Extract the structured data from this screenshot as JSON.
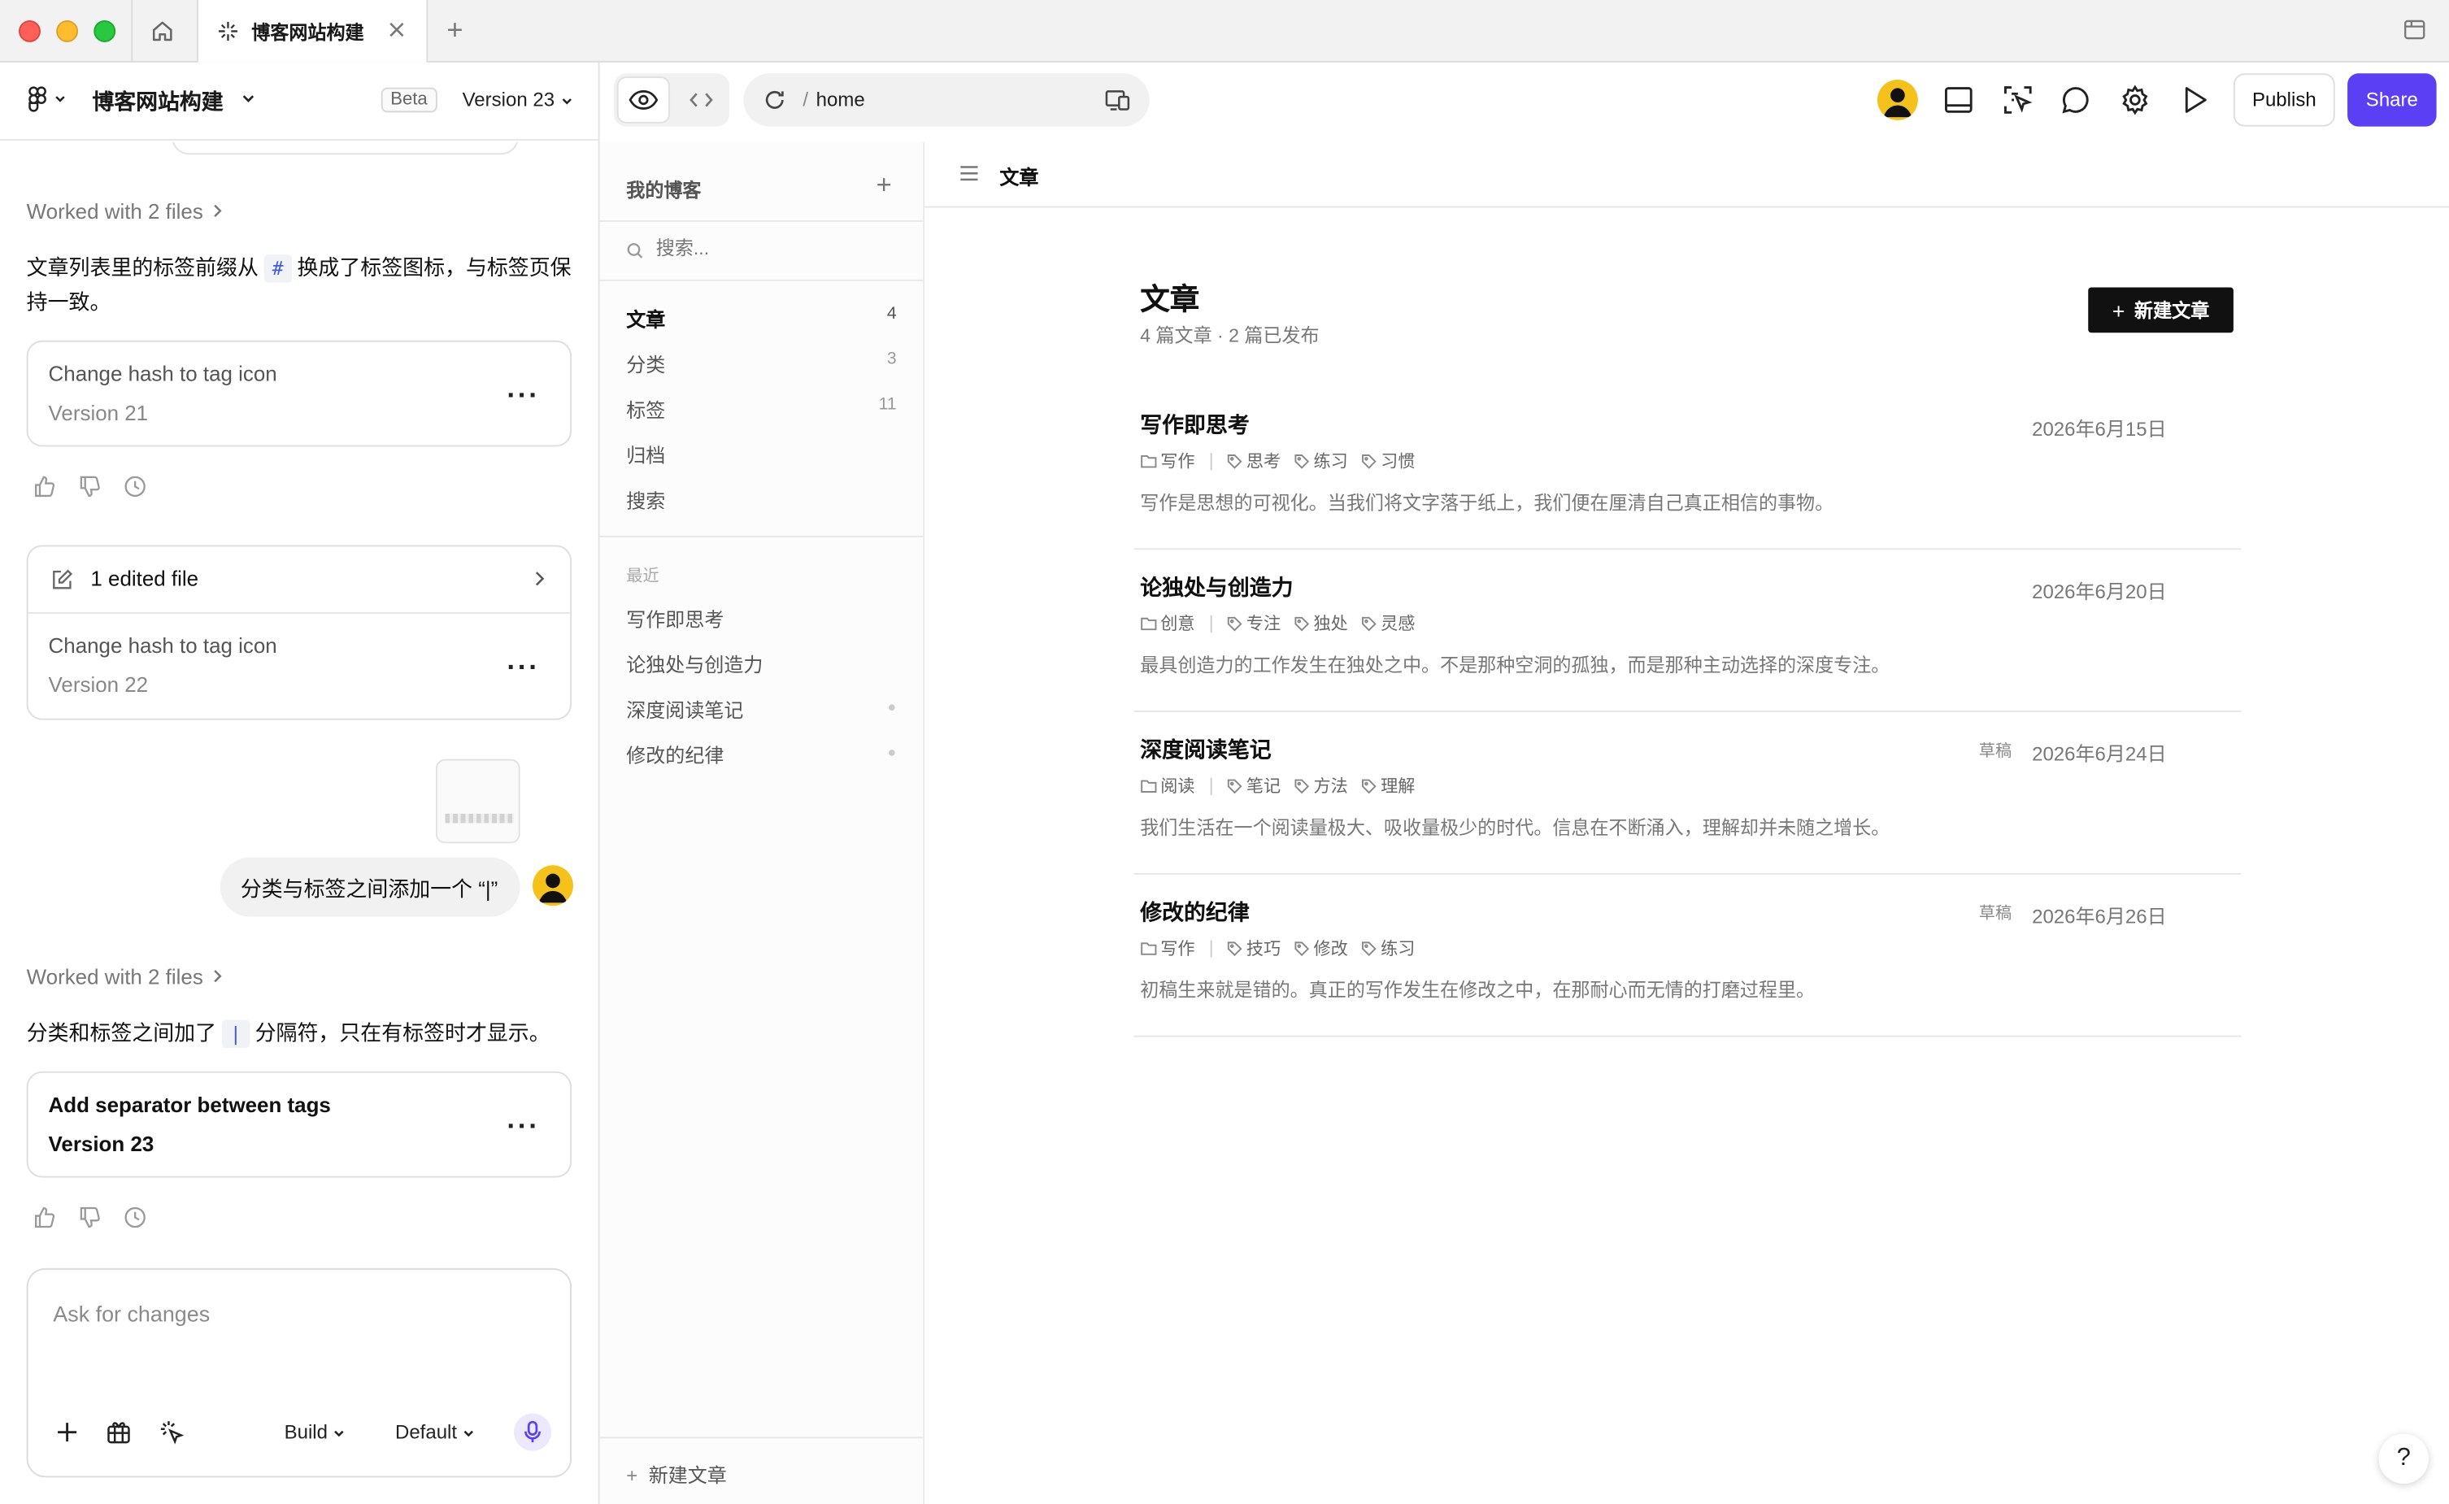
{
  "window": {
    "tab_title": "博客网站构建"
  },
  "toolbar": {
    "project_title": "博客网站构建",
    "beta_label": "Beta",
    "version_label": "Version 23",
    "url_path": "home",
    "publish_label": "Publish",
    "share_label": "Share",
    "accent_color": "#5b3ff5"
  },
  "chat": {
    "worked_1": "Worked with 2 files",
    "msg_1_before": "文章列表里的标签前缀从",
    "msg_1_chip": "#",
    "msg_1_after": "换成了标签图标，与标签页保持一致。",
    "card_1": {
      "title": "Change hash to tag icon",
      "version": "Version 21"
    },
    "edited_files_label": "1 edited file",
    "card_2": {
      "title": "Change hash to tag icon",
      "version": "Version 22"
    },
    "user_message": "分类与标签之间添加一个 “|”",
    "worked_2": "Worked with 2 files",
    "msg_2_before": "分类和标签之间加了",
    "msg_2_chip": "|",
    "msg_2_after": "分隔符，只在有标签时才显示。",
    "card_3": {
      "title": "Add separator between tags",
      "version": "Version 23"
    },
    "composer": {
      "placeholder": "Ask for changes",
      "mode": "Build",
      "model": "Default"
    }
  },
  "blog_sidebar": {
    "title": "我的博客",
    "search_placeholder": "搜索...",
    "nav": [
      {
        "label": "文章",
        "count": "4"
      },
      {
        "label": "分类",
        "count": "3"
      },
      {
        "label": "标签",
        "count": "11"
      },
      {
        "label": "归档",
        "count": ""
      },
      {
        "label": "搜索",
        "count": ""
      }
    ],
    "recent_heading": "最近",
    "recent": [
      {
        "label": "写作即思考"
      },
      {
        "label": "论独处与创造力"
      },
      {
        "label": "深度阅读笔记"
      },
      {
        "label": "修改的纪律"
      }
    ],
    "new_post": "新建文章"
  },
  "blog_main": {
    "header_title": "文章",
    "page_title": "文章",
    "subtitle": "4 篇文章 · 2 篇已发布",
    "new_post_button": "新建文章",
    "posts": [
      {
        "title": "写作即思考",
        "date": "2026年6月15日",
        "draft": "",
        "category": "写作",
        "tags": [
          "思考",
          "练习",
          "习惯"
        ],
        "excerpt": "写作是思想的可视化。当我们将文字落于纸上，我们便在厘清自己真正相信的事物。"
      },
      {
        "title": "论独处与创造力",
        "date": "2026年6月20日",
        "draft": "",
        "category": "创意",
        "tags": [
          "专注",
          "独处",
          "灵感"
        ],
        "excerpt": "最具创造力的工作发生在独处之中。不是那种空洞的孤独，而是那种主动选择的深度专注。"
      },
      {
        "title": "深度阅读笔记",
        "date": "2026年6月24日",
        "draft": "草稿",
        "category": "阅读",
        "tags": [
          "笔记",
          "方法",
          "理解"
        ],
        "excerpt": "我们生活在一个阅读量极大、吸收量极少的时代。信息在不断涌入，理解却并未随之增长。"
      },
      {
        "title": "修改的纪律",
        "date": "2026年6月26日",
        "draft": "草稿",
        "category": "写作",
        "tags": [
          "技巧",
          "修改",
          "练习"
        ],
        "excerpt": "初稿生来就是错的。真正的写作发生在修改之中，在那耐心而无情的打磨过程里。"
      }
    ]
  },
  "help_label": "?"
}
